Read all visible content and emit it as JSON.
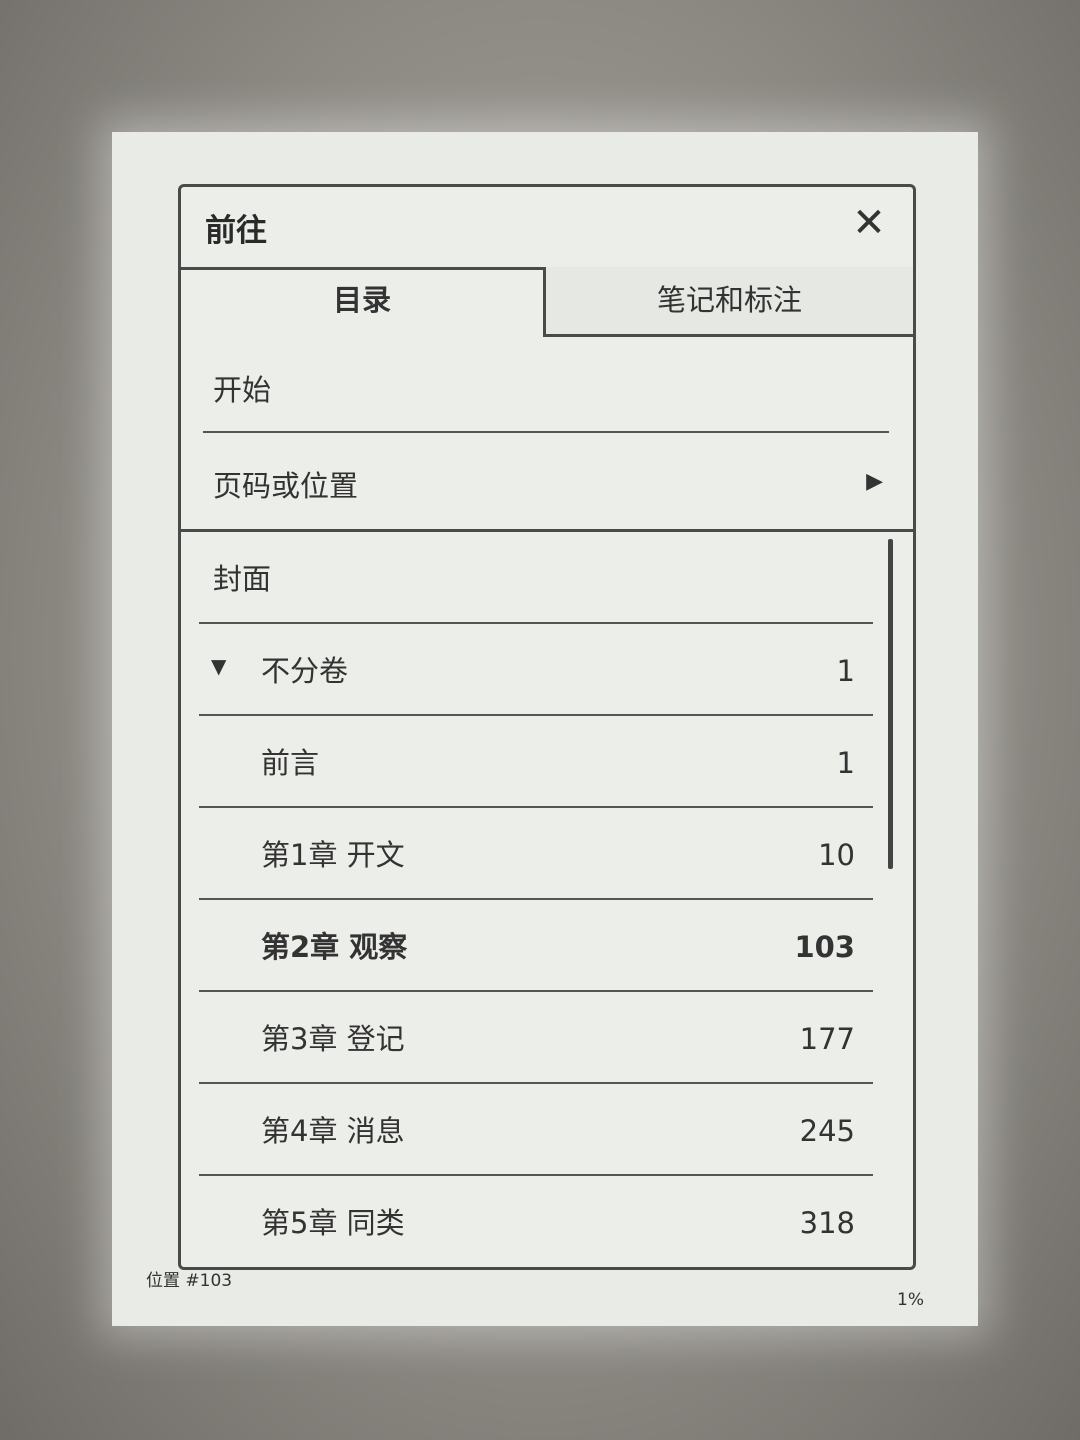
{
  "dialog": {
    "title": "前往",
    "close_icon": "close-icon"
  },
  "tabs": [
    {
      "label": "目录",
      "active": true
    },
    {
      "label": "笔记和标注",
      "active": false
    }
  ],
  "nav": {
    "start_label": "开始",
    "page_label": "页码或位置",
    "page_arrow": "▶"
  },
  "toc": [
    {
      "title": "封面",
      "page": ""
    },
    {
      "title": "不分卷",
      "page": "1",
      "caret": "▼"
    },
    {
      "title": "前言",
      "page": "1"
    },
    {
      "title": "第1章 开文",
      "page": "10"
    },
    {
      "title": "第2章 观察",
      "page": "103",
      "current": true
    },
    {
      "title": "第3章 登记",
      "page": "177"
    },
    {
      "title": "第4章 消息",
      "page": "245"
    },
    {
      "title": "第5章 同类",
      "page": "318"
    }
  ],
  "status": {
    "location": "位置 #103",
    "percent": "1%"
  }
}
